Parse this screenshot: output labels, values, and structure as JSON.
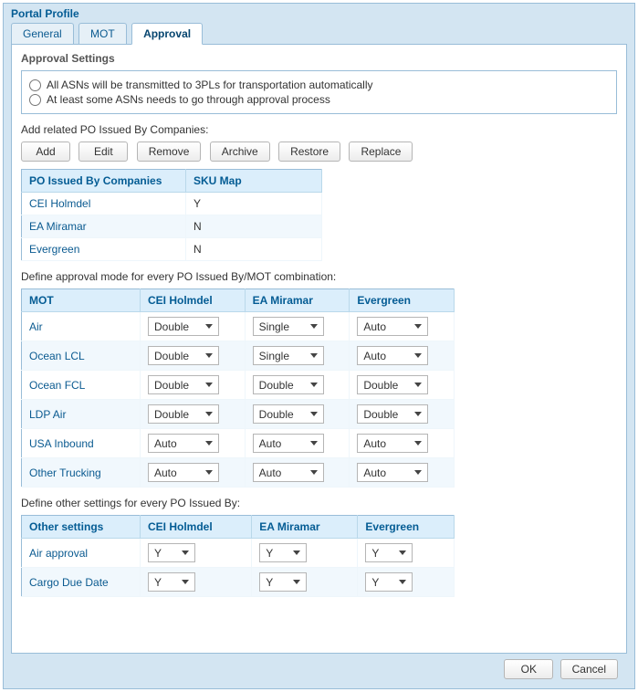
{
  "panel": {
    "title": "Portal Profile"
  },
  "tabs": {
    "general": "General",
    "mot": "MOT",
    "approval": "Approval"
  },
  "approval": {
    "settings_title": "Approval Settings",
    "radio_all": "All ASNs will be transmitted to 3PLs for transportation automatically",
    "radio_some": "At least some ASNs needs to go through approval process",
    "add_label": "Add related PO Issued By Companies:",
    "buttons": {
      "add": "Add",
      "edit": "Edit",
      "remove": "Remove",
      "archive": "Archive",
      "restore": "Restore",
      "replace": "Replace"
    },
    "po_table": {
      "headers": {
        "col0": "PO Issued By Companies",
        "col1": "SKU Map"
      },
      "rows": [
        {
          "company": "CEI Holmdel",
          "sku": "Y"
        },
        {
          "company": "EA Miramar",
          "sku": "N"
        },
        {
          "company": "Evergreen",
          "sku": "N"
        }
      ]
    },
    "mode_label": "Define approval mode for every PO Issued By/MOT combination:",
    "mode_table": {
      "headers": {
        "mot": "MOT",
        "c0": "CEI Holmdel",
        "c1": "EA Miramar",
        "c2": "Evergreen"
      },
      "rows": [
        {
          "mot": "Air",
          "c0": "Double",
          "c1": "Single",
          "c2": "Auto"
        },
        {
          "mot": "Ocean LCL",
          "c0": "Double",
          "c1": "Single",
          "c2": "Auto"
        },
        {
          "mot": "Ocean FCL",
          "c0": "Double",
          "c1": "Double",
          "c2": "Double"
        },
        {
          "mot": "LDP Air",
          "c0": "Double",
          "c1": "Double",
          "c2": "Double"
        },
        {
          "mot": "USA Inbound",
          "c0": "Auto",
          "c1": "Auto",
          "c2": "Auto"
        },
        {
          "mot": "Other Trucking",
          "c0": "Auto",
          "c1": "Auto",
          "c2": "Auto"
        }
      ]
    },
    "other_label": "Define other settings for every PO Issued By:",
    "other_table": {
      "headers": {
        "setting": "Other settings",
        "c0": "CEI Holmdel",
        "c1": "EA Miramar",
        "c2": "Evergreen"
      },
      "rows": [
        {
          "setting": "Air approval",
          "c0": "Y",
          "c1": "Y",
          "c2": "Y"
        },
        {
          "setting": "Cargo Due Date",
          "c0": "Y",
          "c1": "Y",
          "c2": "Y"
        }
      ]
    }
  },
  "footer": {
    "ok": "OK",
    "cancel": "Cancel"
  }
}
